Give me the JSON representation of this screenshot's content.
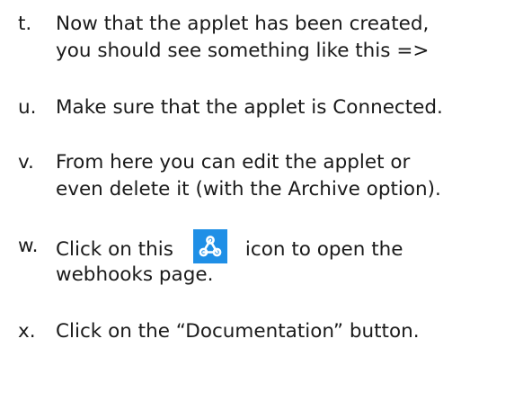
{
  "items": [
    {
      "marker": "t.",
      "lines": [
        "Now that the applet has been created,",
        "you should see something like this =>"
      ]
    },
    {
      "marker": "u.",
      "lines": [
        "Make sure that the applet is Connected."
      ]
    },
    {
      "marker": "v.",
      "lines": [
        "From here you can edit the applet or",
        "even delete it (with the Archive option)."
      ]
    },
    {
      "marker": "w.",
      "before_icon": "Click on this",
      "after_icon": "icon to open the",
      "line2": "webhooks page.",
      "icon": "webhooks-icon",
      "icon_color": "#1f8fe6"
    },
    {
      "marker": "x.",
      "lines": [
        "Click on the “Documentation” button."
      ]
    }
  ]
}
